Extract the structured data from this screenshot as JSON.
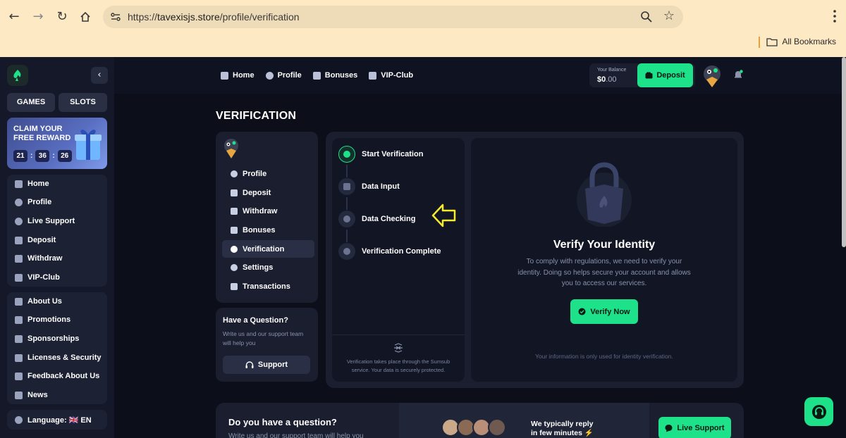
{
  "browser": {
    "url_scheme": "https://",
    "url_host": "tavexisjs.store",
    "url_path": "/profile/verification",
    "bookmarks_label": "All Bookmarks"
  },
  "sidebar": {
    "games": "GAMES",
    "slots": "SLOTS",
    "promo_title": "CLAIM YOUR FREE REWARD",
    "timer": [
      "21",
      "36",
      "26"
    ],
    "group1": [
      "Home",
      "Profile",
      "Live Support",
      "Deposit",
      "Withdraw",
      "VIP-Club"
    ],
    "group2": [
      "About Us",
      "Promotions",
      "Sponsorships",
      "Licenses & Security",
      "Feedback About Us",
      "News"
    ],
    "language": "Language: 🇬🇧 EN"
  },
  "topnav": [
    "Home",
    "Profile",
    "Bonuses",
    "VIP-Club"
  ],
  "balance": {
    "label": "Your Balance",
    "dollars": "$0",
    "cents": ".00"
  },
  "deposit_label": "Deposit",
  "page_title": "VERIFICATION",
  "profile_menu": [
    "Profile",
    "Deposit",
    "Withdraw",
    "Bonuses",
    "Verification",
    "Settings",
    "Transactions"
  ],
  "profile_menu_active": "Verification",
  "question": {
    "title": "Have a Question?",
    "text": "Write us and our support team will help you",
    "button": "Support"
  },
  "steps": [
    "Start Verification",
    "Data Input",
    "Data Checking",
    "Verification Complete"
  ],
  "steps_footer": "Verification takes place through the Sumsub service. Your data is securely protected.",
  "verify": {
    "title": "Verify Your Identity",
    "text": "To comply with regulations, we need to verify your identity. Doing so helps secure your account and allows you to access our services.",
    "button": "Verify Now",
    "note": "Your information is only used for identity verification."
  },
  "bottom": {
    "title": "Do you have a question?",
    "sub": "Write us and our support team will help you",
    "reply_line1": "We typically reply",
    "reply_line2": "in few minutes ⚡",
    "button": "Live Support"
  },
  "colors": {
    "accent": "#1de28a",
    "bg": "#0f1220",
    "card": "#1a1e2f",
    "annotation": "#f6ea2c"
  }
}
